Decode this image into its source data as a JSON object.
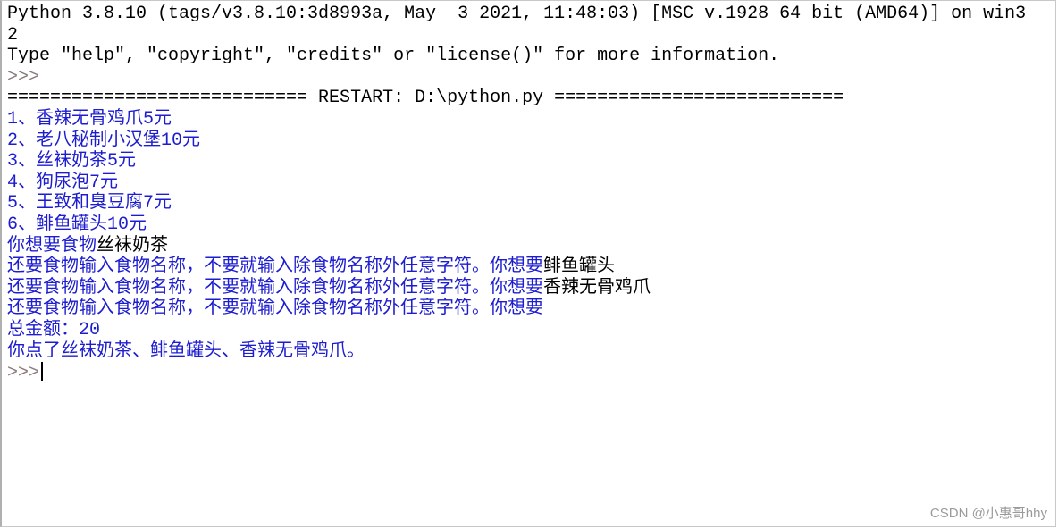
{
  "banner": {
    "line1": "Python 3.8.10 (tags/v3.8.10:3d8993a, May  3 2021, 11:48:03) [MSC v.1928 64 bit (AMD64)] on win3",
    "line2": "2",
    "line3": "Type \"help\", \"copyright\", \"credits\" or \"license()\" for more information."
  },
  "prompt": ">>>",
  "restart": "============================ RESTART: D:\\python.py ===========================",
  "menu": [
    "1、香辣无骨鸡爪5元",
    "2、老八秘制小汉堡10元",
    "3、丝袜奶茶5元",
    "4、狗尿泡7元",
    "5、王致和臭豆腐7元",
    "6、鲱鱼罐头10元"
  ],
  "first_prompt": {
    "text": "你想要食物",
    "input": "丝袜奶茶"
  },
  "more_prompts": [
    {
      "text": "还要食物输入食物名称，不要就输入除食物名称外任意字符。你想要",
      "input": "鲱鱼罐头"
    },
    {
      "text": "还要食物输入食物名称，不要就输入除食物名称外任意字符。你想要",
      "input": "香辣无骨鸡爪"
    },
    {
      "text": "还要食物输入食物名称，不要就输入除食物名称外任意字符。你想要",
      "input": ""
    }
  ],
  "total": "总金额：20",
  "summary": "你点了丝袜奶茶、鲱鱼罐头、香辣无骨鸡爪。",
  "watermark": "CSDN @小惠哥hhy",
  "colors": {
    "stdout": "#1c1cd0",
    "input": "#000000",
    "prompt": "#8a7a7a"
  }
}
